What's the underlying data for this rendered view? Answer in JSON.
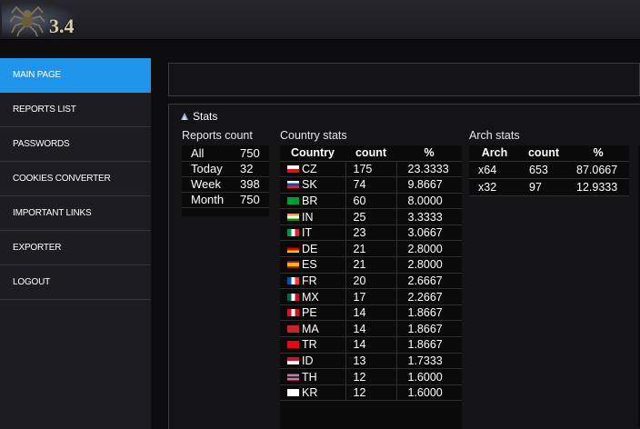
{
  "header": {
    "logo_version": "3.4"
  },
  "sidebar": {
    "items": [
      {
        "label": "MAIN PAGE",
        "active": true
      },
      {
        "label": "REPORTS LIST",
        "active": false
      },
      {
        "label": "PASSWORDS",
        "active": false
      },
      {
        "label": "COOKIES CONVERTER",
        "active": false
      },
      {
        "label": "IMPORTANT LINKS",
        "active": false
      },
      {
        "label": "EXPORTER",
        "active": false
      },
      {
        "label": "LOGOUT",
        "active": false
      }
    ]
  },
  "stats": {
    "title": "Stats",
    "reports_count": {
      "title": "Reports count",
      "rows": [
        {
          "label": "All",
          "value": "750"
        },
        {
          "label": "Today",
          "value": "32"
        },
        {
          "label": "Week",
          "value": "398"
        },
        {
          "label": "Month",
          "value": "750"
        }
      ]
    },
    "country_stats": {
      "title": "Country stats",
      "headers": [
        "Country",
        "count",
        "%"
      ],
      "rows": [
        {
          "country": "CZ",
          "count": "175",
          "pct": "23.3333"
        },
        {
          "country": "SK",
          "count": "74",
          "pct": "9.8667"
        },
        {
          "country": "BR",
          "count": "60",
          "pct": "8.0000"
        },
        {
          "country": "IN",
          "count": "25",
          "pct": "3.3333"
        },
        {
          "country": "IT",
          "count": "23",
          "pct": "3.0667"
        },
        {
          "country": "DE",
          "count": "21",
          "pct": "2.8000"
        },
        {
          "country": "ES",
          "count": "21",
          "pct": "2.8000"
        },
        {
          "country": "FR",
          "count": "20",
          "pct": "2.6667"
        },
        {
          "country": "MX",
          "count": "17",
          "pct": "2.2667"
        },
        {
          "country": "PE",
          "count": "14",
          "pct": "1.8667"
        },
        {
          "country": "MA",
          "count": "14",
          "pct": "1.8667"
        },
        {
          "country": "TR",
          "count": "14",
          "pct": "1.8667"
        },
        {
          "country": "ID",
          "count": "13",
          "pct": "1.7333"
        },
        {
          "country": "TH",
          "count": "12",
          "pct": "1.6000"
        },
        {
          "country": "KR",
          "count": "12",
          "pct": "1.6000"
        }
      ]
    },
    "arch_stats": {
      "title": "Arch stats",
      "headers": [
        "Arch",
        "count",
        "%"
      ],
      "rows": [
        {
          "arch": "x64",
          "count": "653",
          "pct": "87.0667"
        },
        {
          "arch": "x32",
          "count": "97",
          "pct": "12.9333"
        }
      ]
    }
  },
  "colors": {
    "accent": "#1e95ea",
    "background": "#0d0d0f",
    "panel": "#141416"
  }
}
